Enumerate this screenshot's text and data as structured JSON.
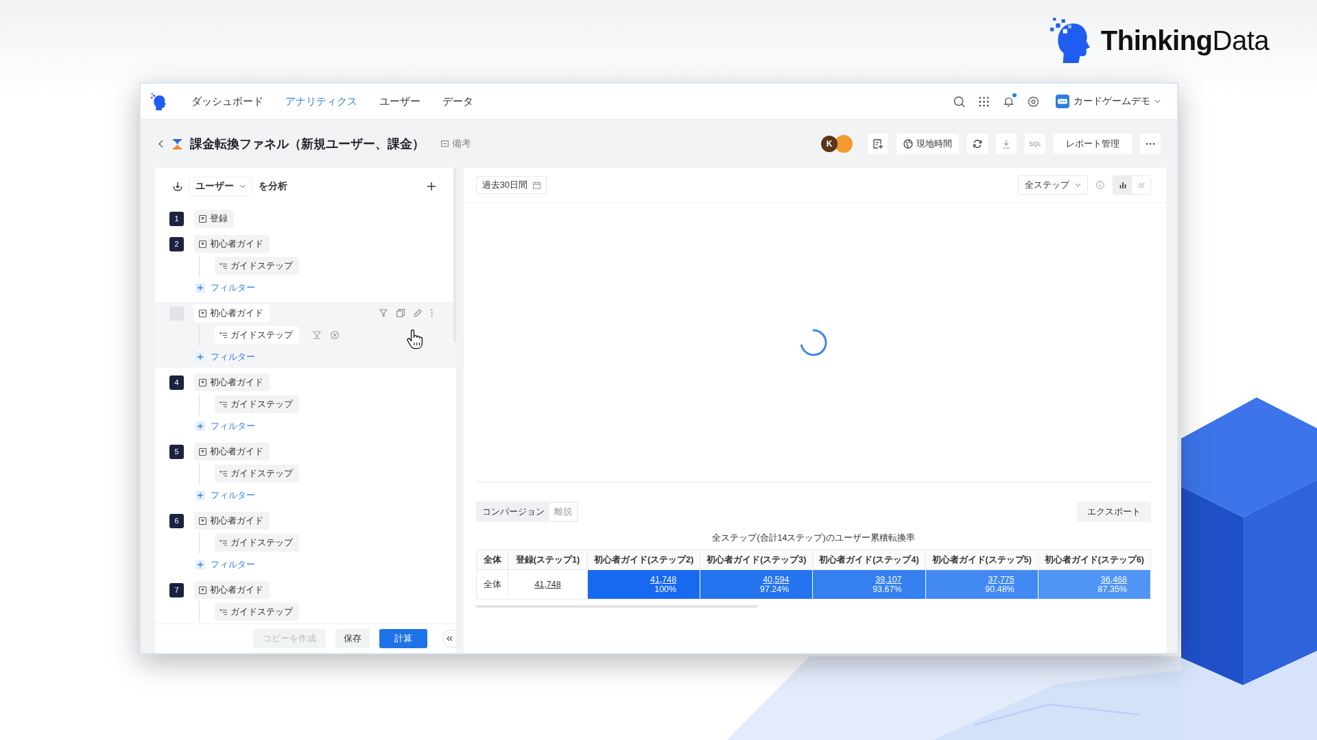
{
  "brand": {
    "name": "**Thinking**Data"
  },
  "nav": {
    "items": [
      {
        "label": "ダッシュボード",
        "selected": false
      },
      {
        "label": "アナリティクス",
        "selected": true
      },
      {
        "label": "ユーザー",
        "selected": false
      },
      {
        "label": "データ",
        "selected": false
      }
    ],
    "notification_dot": true,
    "project": "カードゲームデモ"
  },
  "report": {
    "title": "課金転換ファネル（新規ユーザー、課金）",
    "note": "備考",
    "avatars": [
      {
        "initial": "K",
        "color": "#5b3416"
      },
      {
        "color": "#f29a2e"
      }
    ],
    "local_time": "現地時間",
    "sql": "SQL",
    "manage": "レポート管理"
  },
  "analysis": {
    "subject": "ユーザー",
    "suffix": "を分析",
    "steps": [
      {
        "number": "1",
        "event": "登録",
        "hovered": false
      },
      {
        "number": "2",
        "event": "初心者ガイド",
        "property": "ガイドステップ",
        "filter": "フィルター",
        "hovered": false
      },
      {
        "event": "初心者ガイド",
        "property": "ガイドステップ",
        "filter": "フィルター",
        "hovered": true
      },
      {
        "number": "4",
        "event": "初心者ガイド",
        "property": "ガイドステップ",
        "filter": "フィルター",
        "hovered": false
      },
      {
        "number": "5",
        "event": "初心者ガイド",
        "property": "ガイドステップ",
        "filter": "フィルター",
        "hovered": false
      },
      {
        "number": "6",
        "event": "初心者ガイド",
        "property": "ガイドステップ",
        "filter": "フィルター",
        "hovered": false
      },
      {
        "number": "7",
        "event": "初心者ガイド",
        "property": "ガイドステップ",
        "hovered": false
      }
    ],
    "footer_buttons": [
      {
        "label": "コピーを作成",
        "kind": "disabled"
      },
      {
        "label": "保存",
        "kind": "default"
      },
      {
        "label": "計算",
        "kind": "primary"
      }
    ]
  },
  "chart": {
    "date_range": "過去30日間",
    "step_scope": "全ステップ",
    "views": [
      {
        "kind": "bar",
        "selected": true
      },
      {
        "kind": "line",
        "selected": false
      }
    ],
    "loading": true
  },
  "table": {
    "tabs": [
      {
        "label": "コンバージョン",
        "selected": true
      },
      {
        "label": "離脱",
        "selected": false
      }
    ],
    "export": "エクスポート",
    "caption": "全ステップ(合計14ステップ)のユーザー累積転換率",
    "columns": [
      "全体",
      "登録(ステップ1)",
      "初心者ガイド(ステップ2)",
      "初心者ガイド(ステップ3)",
      "初心者ガイド(ステップ4)",
      "初心者ガイド(ステップ5)",
      "初心者ガイド(ステップ6)"
    ],
    "rows": [
      {
        "cells": [
          {
            "label": "全体"
          },
          {
            "count": "41,748"
          },
          {
            "count": "41,748",
            "rate": "100%",
            "color": "#1769ef"
          },
          {
            "count": "40,594",
            "rate": "97.24%",
            "color": "#2473ef"
          },
          {
            "count": "39,107",
            "rate": "93.67%",
            "color": "#3580f1"
          },
          {
            "count": "37,775",
            "rate": "90.48%",
            "color": "#428af2"
          },
          {
            "count": "36,468",
            "rate": "87.35%",
            "color": "#5095f4"
          }
        ]
      }
    ]
  }
}
